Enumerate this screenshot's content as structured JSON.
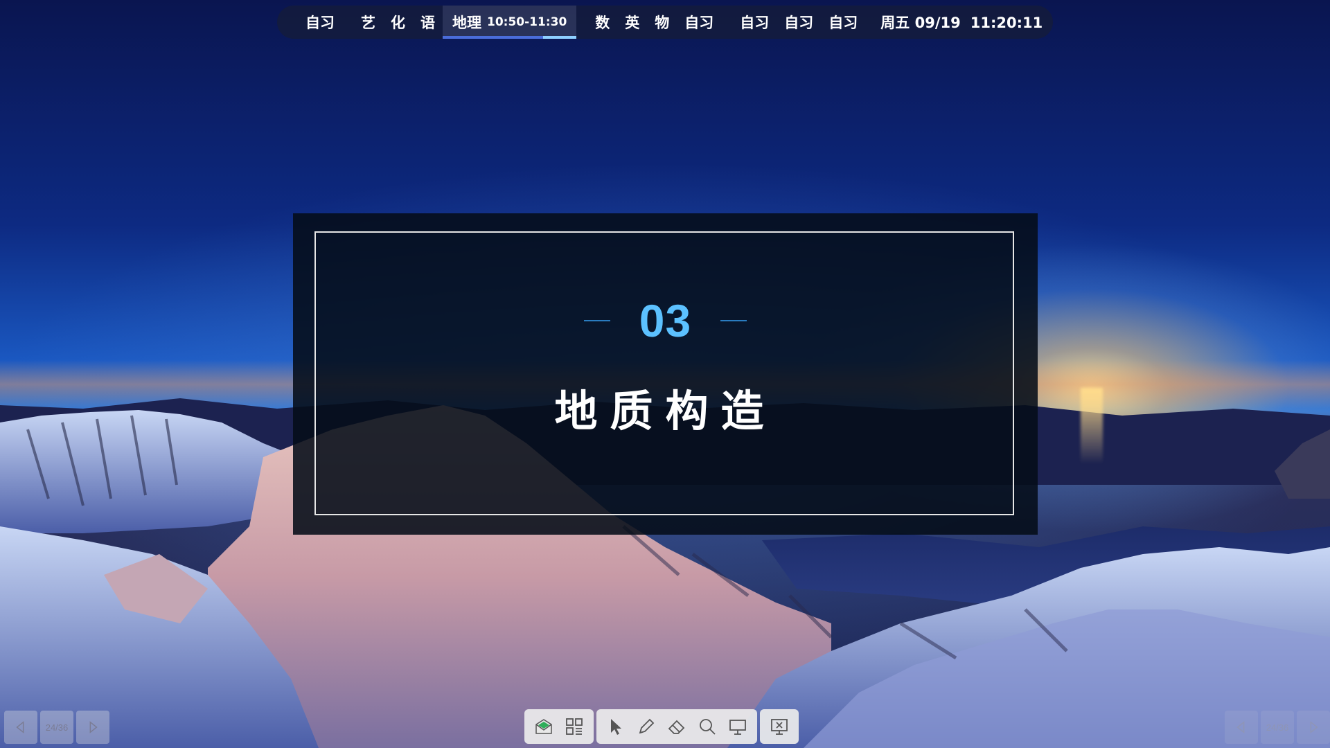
{
  "schedule": {
    "slots_group1": [
      "自习"
    ],
    "slots_group2": [
      "艺",
      "化",
      "语"
    ],
    "current": {
      "subject": "地理",
      "time": "10:50-11:30",
      "progress": 0.75
    },
    "slots_group3": [
      "数",
      "英",
      "物",
      "自习"
    ],
    "slots_group4": [
      "自习",
      "自习",
      "自习"
    ],
    "date": "周五 09/19",
    "clock": "11:20:11"
  },
  "slide": {
    "number": "03",
    "title": "地质构造"
  },
  "navigation": {
    "page_left": "24/36",
    "page_right": "24/36"
  },
  "toolbar": {
    "icons": [
      "board-icon",
      "grid-icon",
      "pointer-icon",
      "pen-icon",
      "eraser-icon",
      "magnifier-icon",
      "presentation-icon",
      "close-slideshow-icon"
    ]
  },
  "colors": {
    "accent": "#5cc1ff",
    "schedule_bg": "#141c3a",
    "progress": "#4a6cd9"
  }
}
